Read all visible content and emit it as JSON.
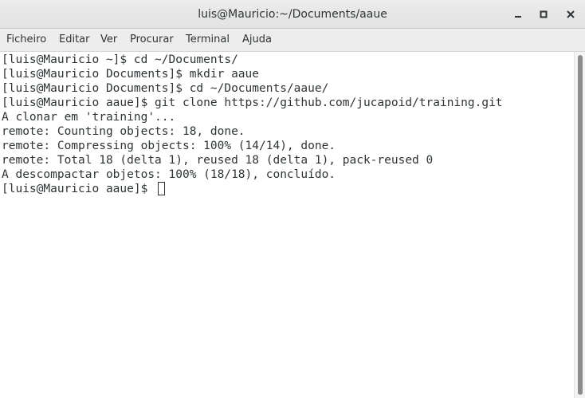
{
  "window": {
    "title": "luis@Mauricio:~/Documents/aaue",
    "minimize_icon": "minimize-icon",
    "maximize_icon": "maximize-icon",
    "close_icon": "close-icon"
  },
  "menubar": {
    "items": [
      "Ficheiro",
      "Editar",
      "Ver",
      "Procurar",
      "Terminal",
      "Ajuda"
    ]
  },
  "terminal": {
    "lines": [
      "[luis@Mauricio ~]$ cd ~/Documents/",
      "[luis@Mauricio Documents]$ mkdir aaue",
      "[luis@Mauricio Documents]$ cd ~/Documents/aaue/",
      "[luis@Mauricio aaue]$ git clone https://github.com/jucapoid/training.git",
      "A clonar em 'training'...",
      "remote: Counting objects: 18, done.",
      "remote: Compressing objects: 100% (14/14), done.",
      "remote: Total 18 (delta 1), reused 18 (delta 1), pack-reused 0",
      "A descompactar objetos: 100% (18/18), concluído.",
      "[luis@Mauricio aaue]$ "
    ]
  },
  "colors": {
    "text": "#2e3436",
    "titlebar": "#e6e6e6",
    "background": "#ffffff"
  }
}
